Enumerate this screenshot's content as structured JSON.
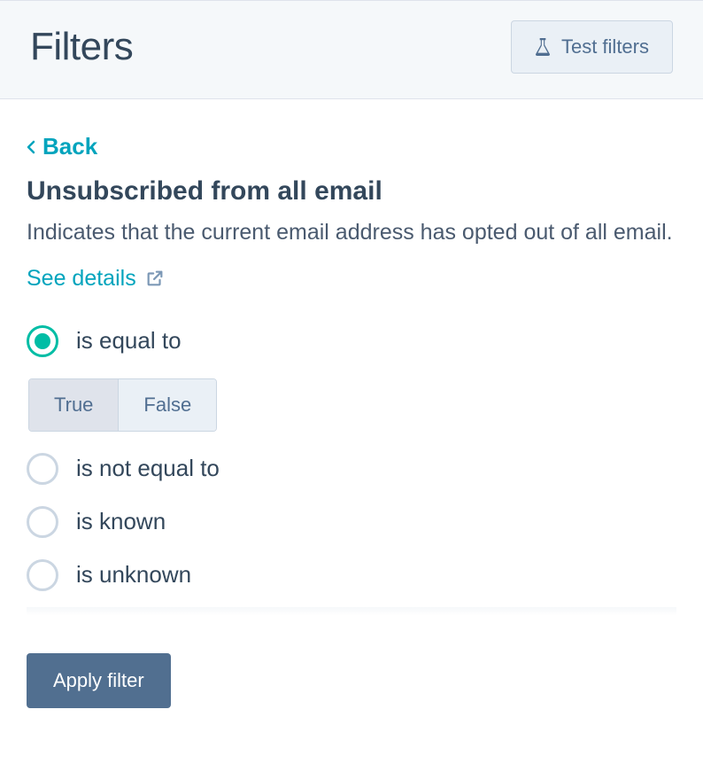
{
  "header": {
    "title": "Filters",
    "test_label": "Test filters"
  },
  "back": {
    "label": "Back"
  },
  "section": {
    "title": "Unsubscribed from all email",
    "description": "Indicates that the current email address has opted out of all email.",
    "details_label": "See details"
  },
  "options": {
    "equal_to": "is equal to",
    "not_equal_to": "is not equal to",
    "is_known": "is known",
    "is_unknown": "is unknown",
    "true_label": "True",
    "false_label": "False"
  },
  "footer": {
    "apply_label": "Apply filter"
  }
}
